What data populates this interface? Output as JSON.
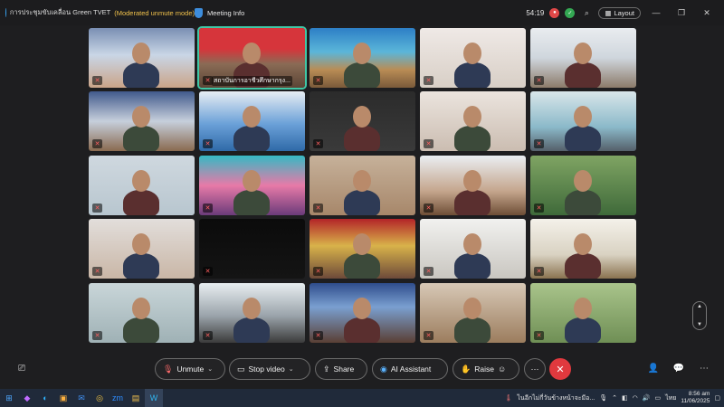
{
  "window": {
    "meeting_title": "การประชุมขับเคลื่อน Green TVET",
    "mode_label": "(Moderated unmute mode)",
    "info_label": "Meeting Info",
    "timer": "54:19",
    "layout_label": "Layout"
  },
  "tiles": [
    {
      "scene": "office",
      "active": false,
      "name": ""
    },
    {
      "scene": "banner-red",
      "active": true,
      "name": "สถาบันการอาชีวศึกษากรุง..."
    },
    {
      "scene": "poster-sea",
      "active": false,
      "name": ""
    },
    {
      "scene": "two-people",
      "active": false,
      "name": ""
    },
    {
      "scene": "meeting-room",
      "active": false,
      "name": ""
    },
    {
      "scene": "hall",
      "active": false,
      "name": ""
    },
    {
      "scene": "conference-blue",
      "active": false,
      "name": ""
    },
    {
      "scene": "dark-person",
      "active": false,
      "name": ""
    },
    {
      "scene": "man-closeup",
      "active": false,
      "name": ""
    },
    {
      "scene": "masked",
      "active": false,
      "name": ""
    },
    {
      "scene": "woman",
      "active": false,
      "name": ""
    },
    {
      "scene": "banner-teal",
      "active": false,
      "name": ""
    },
    {
      "scene": "man-room",
      "active": false,
      "name": ""
    },
    {
      "scene": "big-room",
      "active": false,
      "name": ""
    },
    {
      "scene": "man-green",
      "active": false,
      "name": ""
    },
    {
      "scene": "man-close2",
      "active": false,
      "name": ""
    },
    {
      "scene": "black",
      "active": false,
      "name": ""
    },
    {
      "scene": "red-banner-man",
      "active": false,
      "name": ""
    },
    {
      "scene": "older-man",
      "active": false,
      "name": ""
    },
    {
      "scene": "presentation",
      "active": false,
      "name": ""
    },
    {
      "scene": "woman-glasses",
      "active": false,
      "name": ""
    },
    {
      "scene": "room-window",
      "active": false,
      "name": ""
    },
    {
      "scene": "speaker-banner",
      "active": false,
      "name": ""
    },
    {
      "scene": "office2",
      "active": false,
      "name": ""
    },
    {
      "scene": "two-women",
      "active": false,
      "name": ""
    }
  ],
  "controls": {
    "unmute": "Unmute",
    "stop_video": "Stop video",
    "share": "Share",
    "ai_assistant": "AI Assistant",
    "raise": "Raise"
  },
  "taskbar": {
    "notification": "ไนอีกไม่กี่วันข้างหน้าจะมีอ...",
    "time": "8:56 am",
    "date": "11/06/2025",
    "lang": "ไทย"
  },
  "colors": {
    "accent_green": "#3fc7a6",
    "leave_red": "#e0393e",
    "mode_yellow": "#f0c14b"
  }
}
